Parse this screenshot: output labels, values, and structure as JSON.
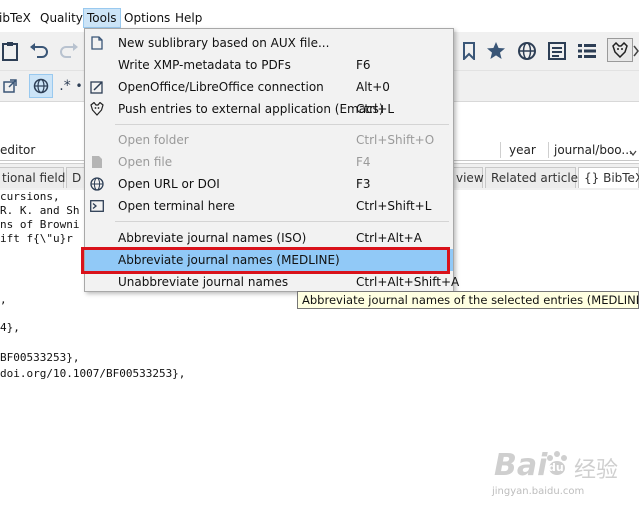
{
  "menubar": {
    "items": [
      "ibTeX",
      "Quality",
      "Tools",
      "Options",
      "Help"
    ],
    "active": "Tools"
  },
  "table_header": {
    "columns": [
      "editor",
      "year",
      "journal/boo..."
    ]
  },
  "tabs": [
    "tional fields",
    "D",
    "view",
    "Related articles",
    "{} BibTeX"
  ],
  "editor_lines": [
    "cursions,",
    "R. K. and Sh",
    "ns of Browni",
    "ift f{\\\"u}r",
    "",
    "",
    ",",
    "",
    "4},",
    "",
    "BF00533253},",
    "doi.org/10.1007/BF00533253},"
  ],
  "tools_menu": {
    "items": [
      {
        "label": "New sublibrary based on AUX file...",
        "shortcut": "",
        "icon": "new-file-icon",
        "disabled": false
      },
      {
        "label": "Write XMP-metadata to PDFs",
        "shortcut": "F6",
        "icon": "",
        "disabled": false
      },
      {
        "label": "OpenOffice/LibreOffice connection",
        "shortcut": "Alt+0",
        "icon": "edit-box-icon",
        "disabled": false
      },
      {
        "label": "Push entries to external application (Emacs)",
        "shortcut": "Ctrl+L",
        "icon": "gnu-icon",
        "disabled": false
      },
      {
        "label": "Open folder",
        "shortcut": "Ctrl+Shift+O",
        "icon": "",
        "disabled": true
      },
      {
        "label": "Open file",
        "shortcut": "F4",
        "icon": "file-icon",
        "disabled": true
      },
      {
        "label": "Open URL or DOI",
        "shortcut": "F3",
        "icon": "globe-icon",
        "disabled": false
      },
      {
        "label": "Open terminal here",
        "shortcut": "Ctrl+Shift+L",
        "icon": "terminal-icon",
        "disabled": false
      },
      {
        "label": "Abbreviate journal names (ISO)",
        "shortcut": "Ctrl+Alt+A",
        "icon": "",
        "disabled": false
      },
      {
        "label": "Abbreviate journal names (MEDLINE)",
        "shortcut": "",
        "icon": "",
        "disabled": false,
        "highlighted": true
      },
      {
        "label": "Unabbreviate journal names",
        "shortcut": "Ctrl+Alt+Shift+A",
        "icon": "",
        "disabled": false
      }
    ]
  },
  "tooltip": "Abbreviate journal names of the selected entries (MEDLINE abbre",
  "watermark": {
    "brand": "Bai",
    "paw": "du",
    "cn": "经验",
    "url": "jingyan.baidu.com"
  },
  "colors": {
    "highlight": "#91c9f7",
    "callout": "#d9121b",
    "tooltip_bg": "#ffffe1"
  }
}
